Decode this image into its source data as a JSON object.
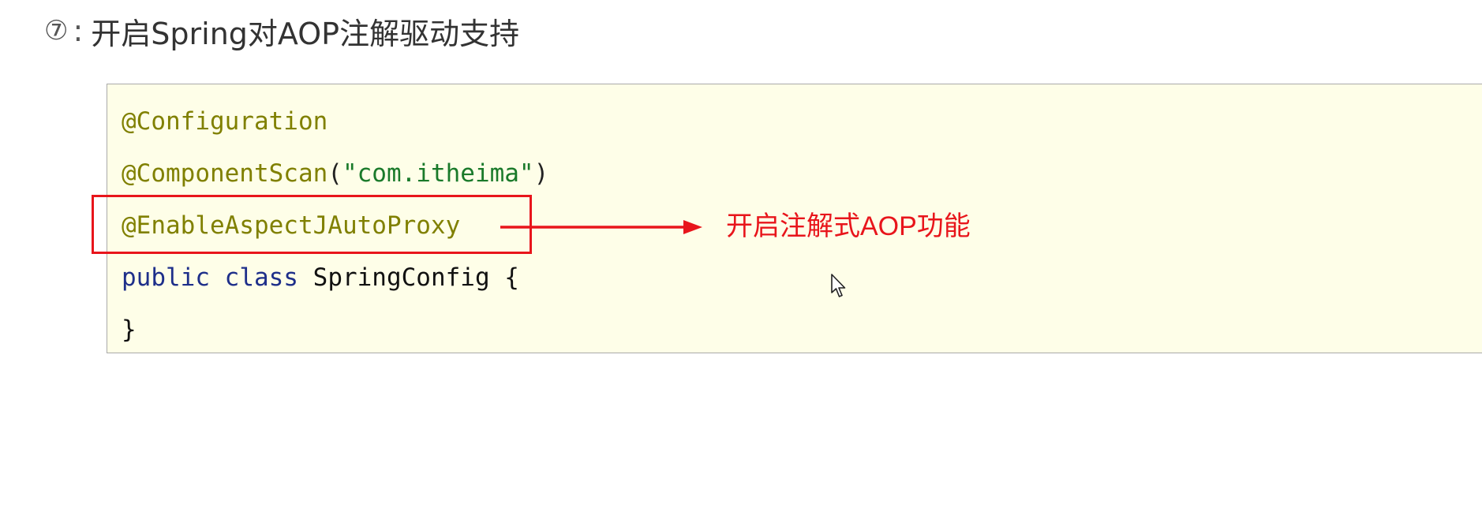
{
  "heading": {
    "step_number": "⑦",
    "separator": ":",
    "title": "开启Spring对AOP注解驱动支持"
  },
  "code": {
    "line1": {
      "annotation": "@Configuration"
    },
    "line2": {
      "annotation": "@ComponentScan",
      "open": "(",
      "string": "\"com.itheima\"",
      "close": ")"
    },
    "line3": {
      "annotation": "@EnableAspectJAutoProxy"
    },
    "line4": {
      "kw1": "public",
      "kw2": "class",
      "name": "SpringConfig",
      "brace": "{"
    },
    "line5": {
      "brace": "}"
    }
  },
  "callout": {
    "label": "开启注解式AOP功能"
  },
  "icons": {
    "arrow": "arrow-right-icon",
    "cursor": "mouse-cursor-icon"
  },
  "colors": {
    "annotation": "#808000",
    "string": "#1a7a2a",
    "keyword": "#1e2f8a",
    "highlight": "#e8151b",
    "code_background": "#fefee8"
  }
}
